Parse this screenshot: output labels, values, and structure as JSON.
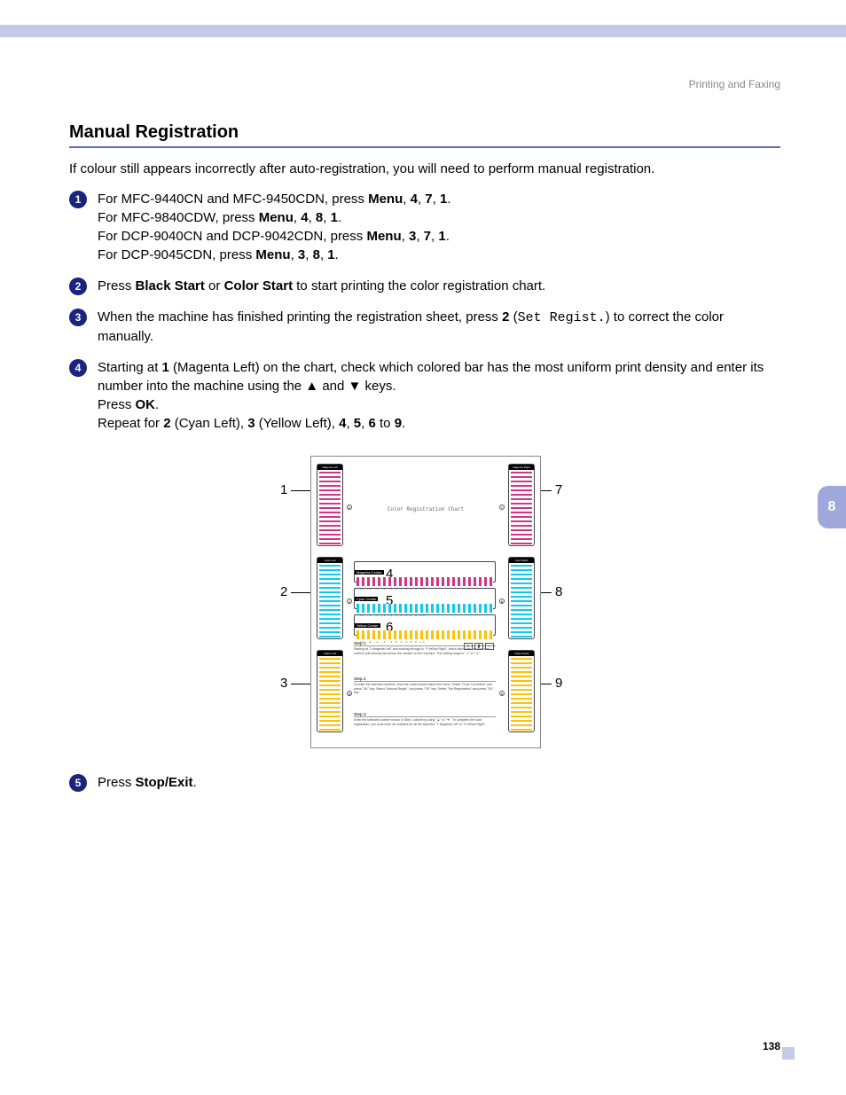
{
  "header": {
    "breadcrumb": "Printing and Faxing"
  },
  "section": {
    "title": "Manual Registration",
    "intro": "If colour still appears incorrectly after auto-registration, you will need to perform manual registration."
  },
  "steps": {
    "s1": {
      "num": "1",
      "l1a": "For MFC-9440CN and MFC-9450CDN, press ",
      "l1b": "Menu",
      "l1c": ", ",
      "l1d": "4",
      "l1e": ", ",
      "l1f": "7",
      "l1g": ", ",
      "l1h": "1",
      "l1i": ".",
      "l2a": "For MFC-9840CDW, press ",
      "l2b": "Menu",
      "l2c": ", ",
      "l2d": "4",
      "l2e": ", ",
      "l2f": "8",
      "l2g": ", ",
      "l2h": "1",
      "l2i": ".",
      "l3a": "For DCP-9040CN and DCP-9042CDN, press ",
      "l3b": "Menu",
      "l3c": ", ",
      "l3d": "3",
      "l3e": ", ",
      "l3f": "7",
      "l3g": ", ",
      "l3h": "1",
      "l3i": ".",
      "l4a": "For DCP-9045CDN, press ",
      "l4b": "Menu",
      "l4c": ", ",
      "l4d": "3",
      "l4e": ", ",
      "l4f": "8",
      "l4g": ", ",
      "l4h": "1",
      "l4i": "."
    },
    "s2": {
      "num": "2",
      "a": "Press ",
      "b": "Black Start",
      "c": " or ",
      "d": "Color Start",
      "e": " to start printing the color registration chart."
    },
    "s3": {
      "num": "3",
      "a": "When the machine has finished printing the registration sheet, press ",
      "b": "2",
      "c": " (",
      "d": "Set Regist.",
      "e": ") to correct the color manually."
    },
    "s4": {
      "num": "4",
      "a": "Starting at ",
      "b": "1",
      "c": " (Magenta Left) on the chart, check which colored bar has the most uniform print density and enter its number into the machine using the ▲ and ▼ keys.",
      "d": "Press ",
      "e": "OK",
      "f": ".",
      "g": "Repeat for ",
      "h": "2",
      "i": " (Cyan Left), ",
      "j": "3",
      "k": " (Yellow Left), ",
      "l": "4",
      "m": ", ",
      "n": "5",
      "o": ", ",
      "p": "6",
      "q": " to ",
      "r": "9",
      "s": "."
    },
    "s5": {
      "num": "5",
      "a": "Press ",
      "b": "Stop/Exit",
      "c": "."
    }
  },
  "chart": {
    "title": "Color Registration Chart",
    "left": {
      "h1": "Magenta Left",
      "h2": "Cyan Left",
      "h3": "Yellow Left"
    },
    "right": {
      "h1": "Magenta Right",
      "h2": "Cyan Right",
      "h3": "Yellow Right"
    },
    "center": {
      "h1": "Magenta Center",
      "h2": "Cyan Center",
      "h3": "Yellow Center"
    },
    "scale": "-10 -8 -6 -4 -2 0 2 4 6 8 10",
    "callouts": {
      "n1": "1",
      "n2": "2",
      "n3": "3",
      "n4": "4",
      "n5": "5",
      "n6": "6",
      "n7": "7",
      "n8": "8",
      "n9": "9"
    },
    "instr": {
      "t1": "Step 1",
      "b1": "Starting at \"1 Magenta Left\" and working through to \"9 Yellow Right\", check which bar has the most uniform print density and press the number on the machine. The setting range is \"-1\" to \"+1\".",
      "t2": "Step 2",
      "b2": "To enter the selected numbers, from the control panel select the menu. Select \"Color Correction\" and press \"OK\" key. Select \"Manual Regist.\" and press \"OK\" key. Select \"Set Registration\" and press \"OK\" key.",
      "t3": "Step 3",
      "b3": "Enter the selected number shown in Step 1 above by using \"▲\" or \"▼\". To complete the color registration, you must enter all numbers for all the selection \"1 Magenta Left\" to \"9 Yellow Right\"."
    }
  },
  "sidebar": {
    "chapter": "8"
  },
  "footer": {
    "page": "138"
  }
}
